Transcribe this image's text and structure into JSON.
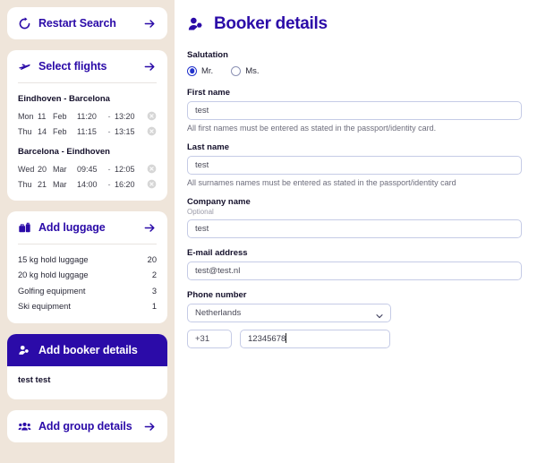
{
  "sidebar": {
    "restart": {
      "label": "Restart Search",
      "icon": "restart-icon",
      "arrow": "arrow-right-icon"
    },
    "flights": {
      "label": "Select flights",
      "icon": "plane-icon",
      "arrow": "arrow-right-icon",
      "segments": [
        {
          "title": "Eindhoven - Barcelona",
          "rows": [
            {
              "day": "Mon",
              "date": "11",
              "month": "Feb",
              "depart": "11:20",
              "dash": "-",
              "arrive": "13:20",
              "remove": "remove-icon"
            },
            {
              "day": "Thu",
              "date": "14",
              "month": "Feb",
              "depart": "11:15",
              "dash": "-",
              "arrive": "13:15",
              "remove": "remove-icon"
            }
          ]
        },
        {
          "title": "Barcelona - Eindhoven",
          "rows": [
            {
              "day": "Wed",
              "date": "20",
              "month": "Mar",
              "depart": "09:45",
              "dash": "-",
              "arrive": "12:05",
              "remove": "remove-icon"
            },
            {
              "day": "Thu",
              "date": "21",
              "month": "Mar",
              "depart": "14:00",
              "dash": "-",
              "arrive": "16:20",
              "remove": "remove-icon"
            }
          ]
        }
      ]
    },
    "luggage": {
      "label": "Add luggage",
      "icon": "suitcase-icon",
      "arrow": "arrow-right-icon",
      "items": [
        {
          "name": "15 kg hold luggage",
          "qty": "20"
        },
        {
          "name": "20 kg hold luggage",
          "qty": "2"
        },
        {
          "name": "Golfing equipment",
          "qty": "3"
        },
        {
          "name": "Ski equipment",
          "qty": "1"
        }
      ]
    },
    "booker": {
      "label": "Add booker details",
      "icon": "person-badge-icon",
      "active": true,
      "summary": "test test"
    },
    "group": {
      "label": "Add group details",
      "icon": "people-icon",
      "arrow": "arrow-right-icon"
    }
  },
  "main": {
    "title": "Booker details",
    "title_icon": "person-badge-icon",
    "salutation": {
      "label": "Salutation",
      "options": [
        {
          "label": "Mr.",
          "selected": true
        },
        {
          "label": "Ms.",
          "selected": false
        }
      ]
    },
    "first_name": {
      "label": "First name",
      "value": "test",
      "help": "All first names must be entered as stated in the passport/identity card."
    },
    "last_name": {
      "label": "Last name",
      "value": "test",
      "help": "All surnames names must be entered as stated in the passport/identity card"
    },
    "company": {
      "label": "Company name",
      "sublabel": "Optional",
      "value": "test"
    },
    "email": {
      "label": "E-mail address",
      "value": "test@test.nl"
    },
    "phone": {
      "label": "Phone number",
      "country": "Netherlands",
      "chevron": "chevron-down-icon",
      "prefix": "+31",
      "number": "12345678"
    }
  },
  "colors": {
    "brand_purple": "#2b0ba8",
    "sidebar_bg": "#efe5da",
    "input_border": "#c5cbe6",
    "radio_accent": "#2233cc"
  }
}
